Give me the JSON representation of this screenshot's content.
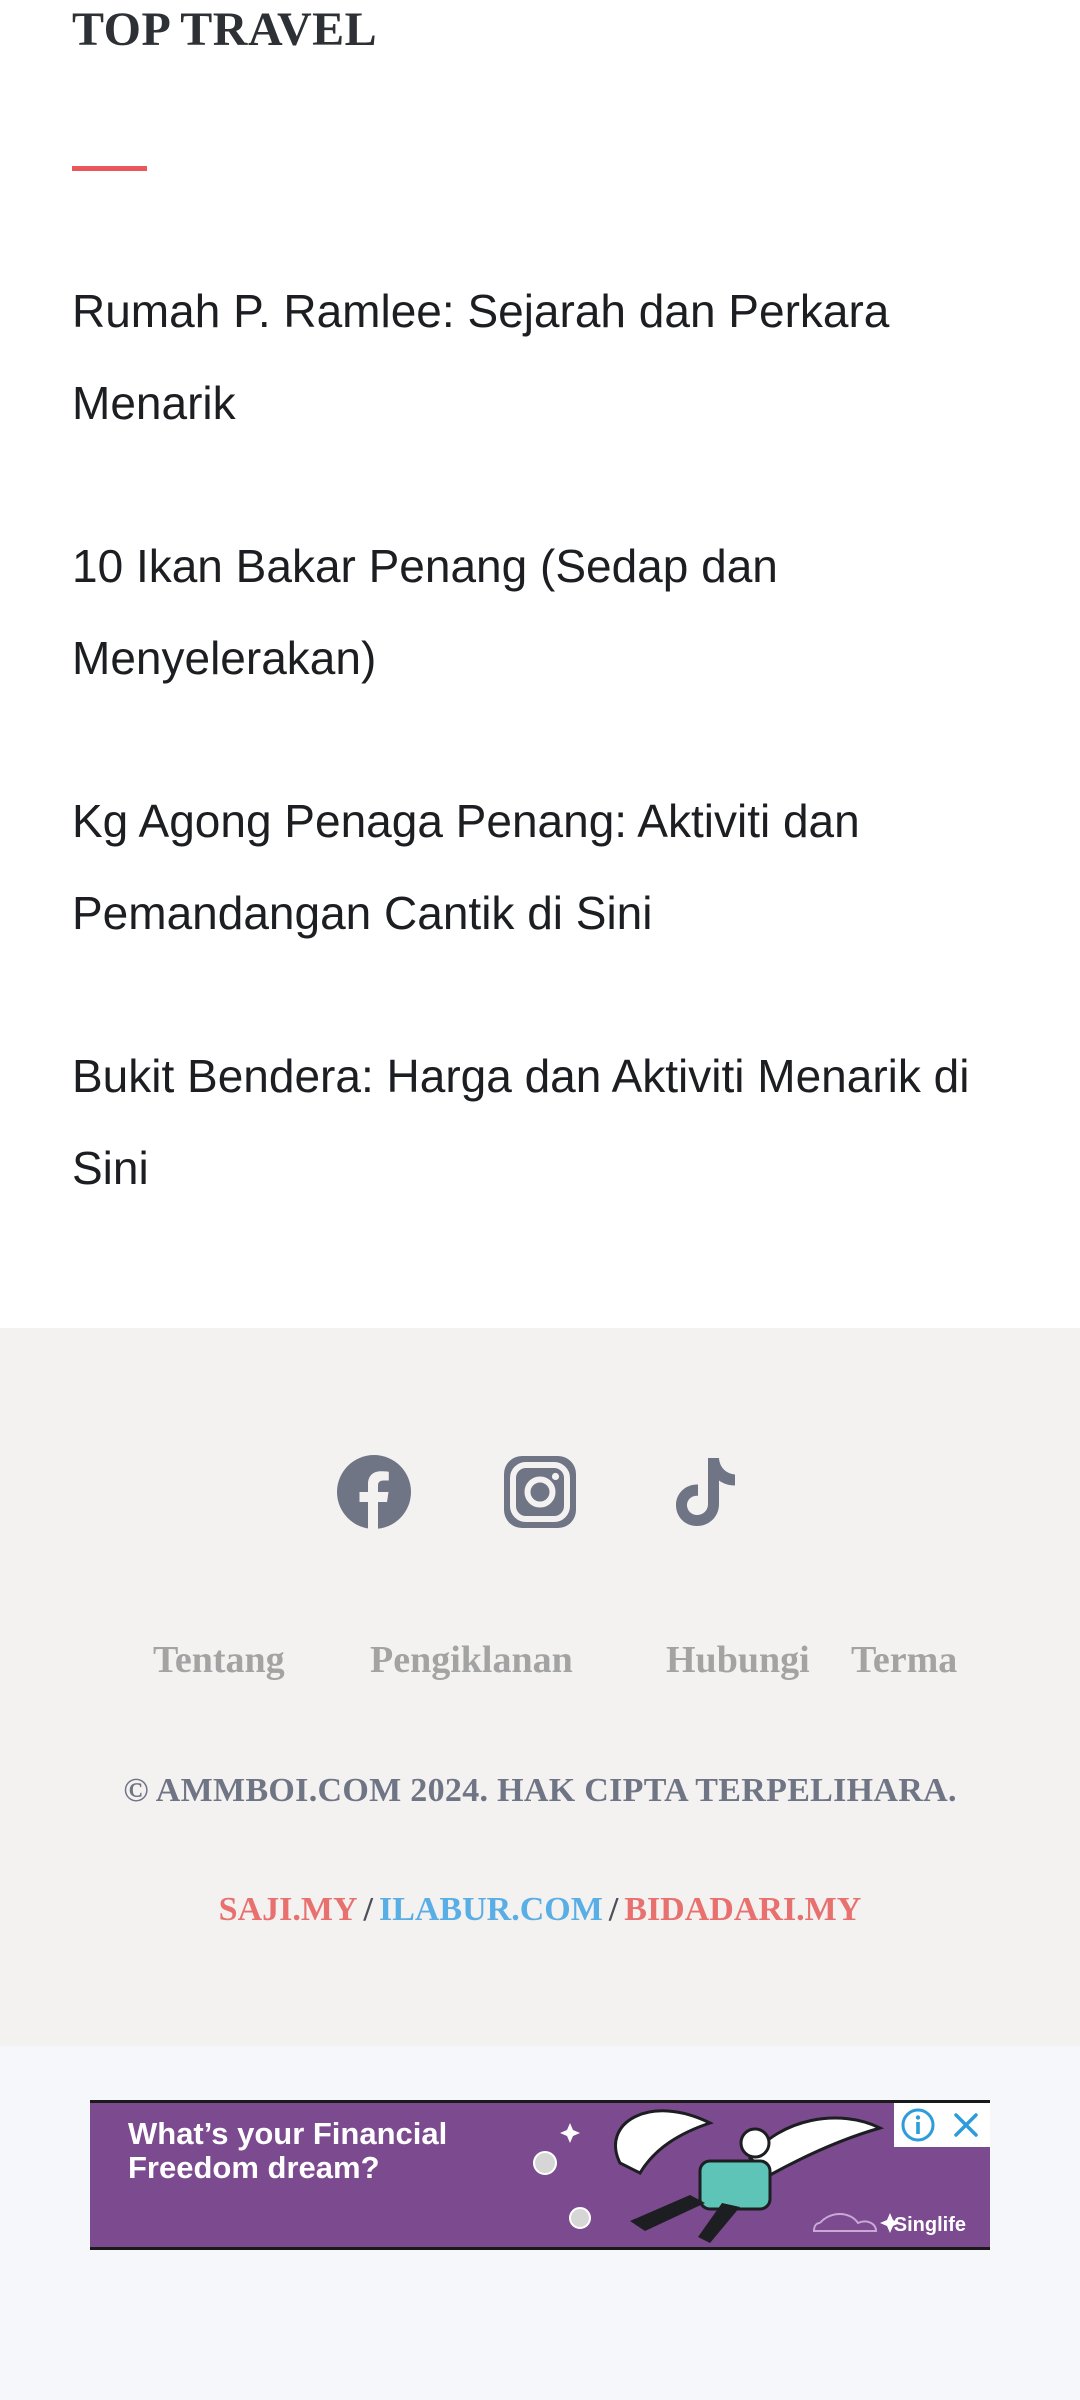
{
  "section": {
    "title": "TOP TRAVEL",
    "accent_color": "#e8585a"
  },
  "travel_items": [
    "Rumah P. Ramlee: Sejarah dan Perkara Menarik",
    "10 Ikan Bakar Penang (Sedap dan Menyelerakan)",
    "Kg Agong Penaga Penang: Aktiviti dan Pemandangan Cantik di Sini",
    "Bukit Bendera: Harga dan Aktiviti Menarik di Sini"
  ],
  "footer": {
    "social": [
      "facebook-icon",
      "instagram-icon",
      "tiktok-icon"
    ],
    "nav": [
      "Tentang",
      "Pengiklanan",
      "Hubungi",
      "Terma"
    ],
    "copyright": "© AMMBOI.COM 2024. HAK CIPTA TERPELIHARA.",
    "sister_sites": [
      {
        "label": "SAJI.MY",
        "color": "#e8716f"
      },
      {
        "label": "ILABUR.COM",
        "color": "#5aaee6"
      },
      {
        "label": "BIDADARI.MY",
        "color": "#e8716f"
      }
    ],
    "separator": "/"
  },
  "ad": {
    "text": "What’s your Financial Freedom dream?",
    "brand": "Singlife",
    "background": "#7c4a8e"
  }
}
